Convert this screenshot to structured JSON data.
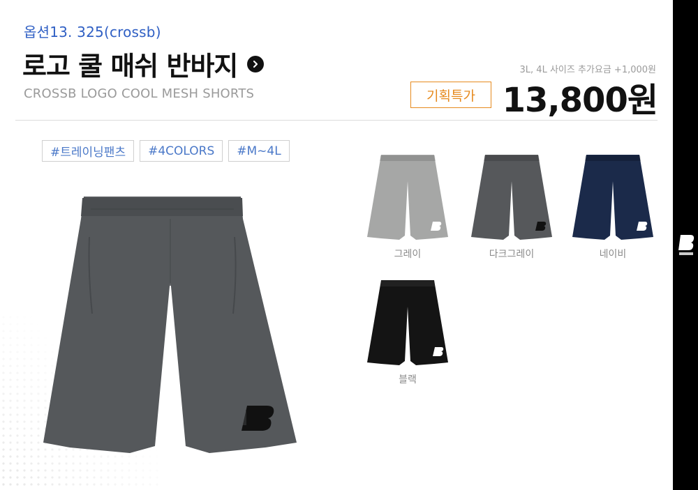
{
  "product": {
    "option_label": "옵션13. 325(crossb)",
    "title": "로고 쿨 매쉬 반바지",
    "subtitle": "CROSSB LOGO COOL MESH SHORTS",
    "size_note": "3L, 4L 사이즈 추가요금 +1,000원",
    "promo_badge": "기획특가",
    "price": "13,800원"
  },
  "tags": [
    "#트레이닝팬츠",
    "#4COLORS",
    "#M~4L"
  ],
  "colors": [
    {
      "label": "그레이",
      "hex": "#a6a7a6"
    },
    {
      "label": "다크그레이",
      "hex": "#56585b"
    },
    {
      "label": "네이비",
      "hex": "#1b2a4a"
    },
    {
      "label": "블랙",
      "hex": "#141414"
    }
  ],
  "main_color": "#55585b",
  "icons": {
    "title_arrow": "chevron-right-icon",
    "brand_logo": "crossb-logo-icon"
  }
}
